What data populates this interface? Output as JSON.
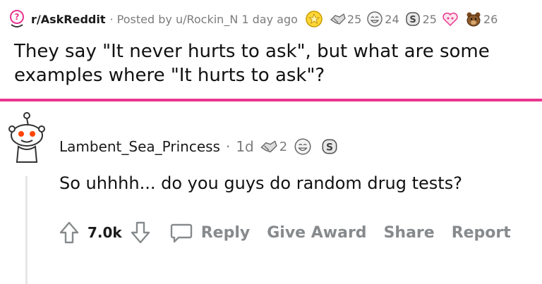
{
  "post": {
    "subreddit": "r/AskReddit",
    "meta": "· Posted by u/Rockin_N 1 day ago",
    "title": "They say \"It never hurts to ask\", but what are some examples where \"It hurts to ask\"?",
    "awards": [
      {
        "icon": "gold-award-icon",
        "count": ""
      },
      {
        "icon": "handshake-award-icon",
        "count": "25"
      },
      {
        "icon": "laugh-award-icon",
        "count": "24"
      },
      {
        "icon": "silver-coin-award-icon",
        "count": "25"
      },
      {
        "icon": "heart-eyes-award-icon",
        "count": ""
      },
      {
        "icon": "bear-award-icon",
        "count": "26"
      }
    ]
  },
  "comment": {
    "username": "Lambent_Sea_Princess",
    "separator": "·",
    "age": "1d",
    "awards": [
      {
        "icon": "handshake-award-icon",
        "count": "2"
      },
      {
        "icon": "laugh-award-icon",
        "count": ""
      },
      {
        "icon": "silver-coin-award-icon",
        "count": ""
      }
    ],
    "body": "So uhhhh... do you guys do random drug tests?",
    "score": "7.0k",
    "actions": {
      "reply": "Reply",
      "give_award": "Give Award",
      "share": "Share",
      "report": "Report"
    }
  },
  "colors": {
    "divider": "#e8368f",
    "muted": "#878a8c"
  }
}
